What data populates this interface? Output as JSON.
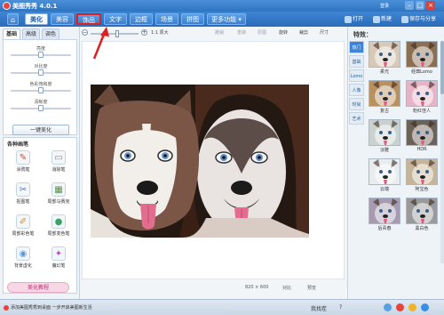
{
  "app": {
    "title": "美图秀秀 4.0.1",
    "top_links": "登录",
    "win_minimize": "–",
    "win_maximize": "□",
    "win_close": "×"
  },
  "tabs": [
    {
      "label": "⌂"
    },
    {
      "label": "美化"
    },
    {
      "label": "美容"
    },
    {
      "label": "饰品"
    },
    {
      "label": "文字"
    },
    {
      "label": "边框"
    },
    {
      "label": "场景"
    },
    {
      "label": "拼图"
    },
    {
      "label": "更多功能 ▾"
    }
  ],
  "header_actions": {
    "open": "打开",
    "new": "新建",
    "save": "保存与分享"
  },
  "left": {
    "subtabs": [
      "基础",
      "高级",
      "调色"
    ],
    "sliders": [
      {
        "label": "亮度",
        "value": 0.5
      },
      {
        "label": "对比度",
        "value": 0.5
      },
      {
        "label": "色彩饱和度",
        "value": 0.5
      },
      {
        "label": "清晰度",
        "value": 0.5
      }
    ],
    "one_key": "一键美化",
    "brush_title": "各种画笔",
    "tools": [
      {
        "label": "涂鸦笔",
        "icon": "pen-icon"
      },
      {
        "label": "消除笔",
        "icon": "eraser-icon"
      },
      {
        "label": "抠图笔",
        "icon": "cutout-icon"
      },
      {
        "label": "局部马赛克",
        "icon": "mosaic-icon"
      },
      {
        "label": "局部彩色笔",
        "icon": "color-brush-icon"
      },
      {
        "label": "局部变色笔",
        "icon": "recolor-icon"
      },
      {
        "label": "背景虚化",
        "icon": "blur-icon"
      },
      {
        "label": "魔幻笔",
        "icon": "magic-icon"
      }
    ],
    "tutorial": "美化教程"
  },
  "canvas_toolbar": {
    "zoom_label": "1:1 原大",
    "zoom_value": 0.55,
    "undo": "撤销",
    "redo": "重做",
    "original": "原图",
    "rotate": "旋转",
    "crop": "裁剪",
    "size": "尺寸"
  },
  "canvas": {
    "dimensions": "820 × 600",
    "compare": "对比",
    "preview": "预览"
  },
  "right": {
    "title": "特效：",
    "categories": [
      "热门",
      "基础",
      "Lomo",
      "人像",
      "时尚",
      "艺术"
    ],
    "effects": [
      {
        "label": "柔光",
        "tint": "#d8c8b8"
      },
      {
        "label": "经典Lomo",
        "tint": "#8c6f52"
      },
      {
        "label": "复古",
        "tint": "#b9915f"
      },
      {
        "label": "粉红佳人",
        "tint": "#e6b4c6"
      },
      {
        "label": "淡雅",
        "tint": "#c9d2cf"
      },
      {
        "label": "HDR",
        "tint": "#6d6258"
      },
      {
        "label": "云端",
        "tint": "#e8ecef"
      },
      {
        "label": "阿宝色",
        "tint": "#c7b59a"
      },
      {
        "label": "后青春",
        "tint": "#a69bb0"
      },
      {
        "label": "黑白色",
        "tint": "#9a9a9a"
      }
    ]
  },
  "status": {
    "message": "添加美图秀秀到桌面 一步开启美图新生活",
    "find_effect": "我找茬",
    "help": "?"
  },
  "colors": {
    "accent": "#2f74c0",
    "highlight": "#e02020"
  }
}
